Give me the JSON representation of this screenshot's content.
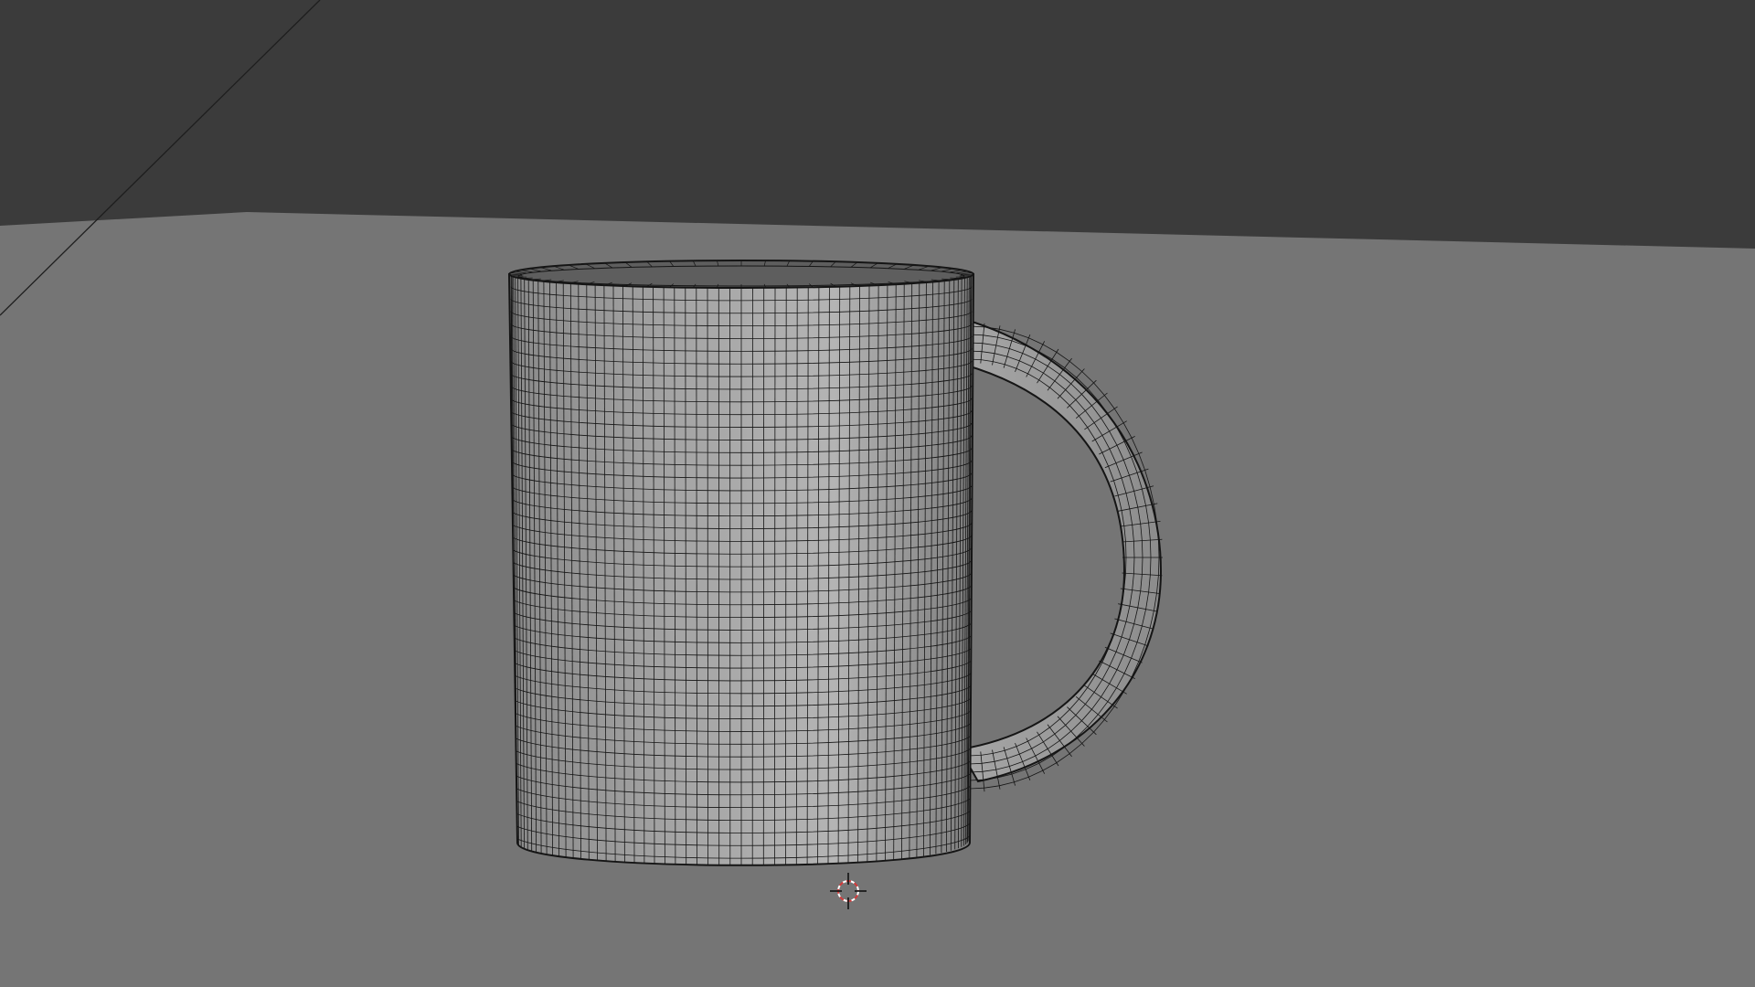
{
  "viewport": {
    "object": "mug",
    "shading": "solid",
    "wireframe_overlay": true
  },
  "colors": {
    "background_wall": "#3b3b3b",
    "floor": "#757575",
    "mug_body": "#9a9a9a",
    "mug_highlight": "#b6b6b6",
    "mug_shadow": "#6f6f6f",
    "wire": "#151515",
    "cursor_red": "#d23a3a",
    "cursor_white": "#ffffff"
  },
  "icons": {
    "cursor": "3d-cursor-icon"
  }
}
